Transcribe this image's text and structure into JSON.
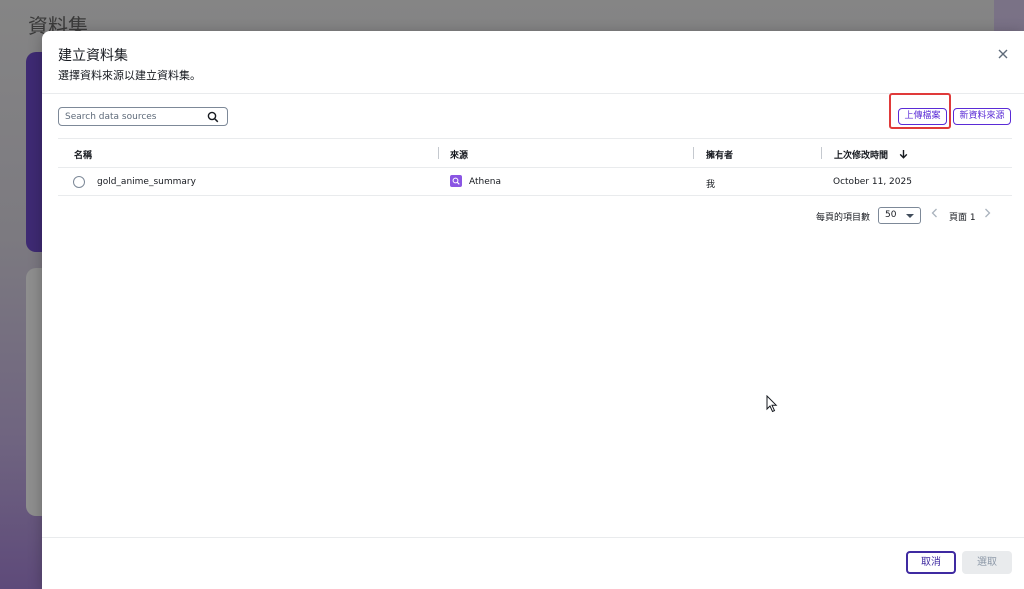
{
  "background": {
    "page_title": "資料集"
  },
  "modal": {
    "title": "建立資料集",
    "subtitle": "選擇資料來源以建立資料集。",
    "close_icon": "close-icon"
  },
  "toolbar": {
    "search_placeholder": "Search data sources",
    "search_value": "",
    "upload_label": "上傳檔案",
    "new_source_label": "新資料來源"
  },
  "table": {
    "columns": [
      "名稱",
      "來源",
      "擁有者",
      "上次修改時間"
    ],
    "sort_column": "上次修改時間",
    "sort_direction": "descending",
    "rows": [
      {
        "name": "gold_anime_summary",
        "source": "Athena",
        "owner": "我",
        "last_modified": "October 11, 2025",
        "selected": false
      }
    ]
  },
  "pagination": {
    "page_size_label": "每頁的項目數",
    "page_size": "50",
    "page_label": "頁面 1"
  },
  "footer": {
    "cancel_label": "取消",
    "select_label": "選取"
  },
  "colors": {
    "accent": "#5a2bd6",
    "primary_button_border": "#3f2aa1",
    "highlight": "#e03a3a",
    "athena_icon": "#8a55e3"
  }
}
